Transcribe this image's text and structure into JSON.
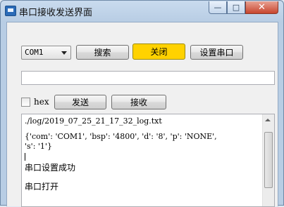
{
  "window": {
    "title": "串口接收发送界面",
    "controls": {
      "minimize": "—",
      "maximize": "□",
      "close": "✕"
    }
  },
  "toolbar": {
    "port_select": {
      "value": "COM1"
    },
    "search_label": "搜索",
    "close_label": "关闭",
    "setup_label": "设置串口"
  },
  "send_input": {
    "value": "",
    "placeholder": ""
  },
  "options": {
    "hex_label": "hex",
    "hex_checked": false,
    "send_label": "发送",
    "receive_label": "接收"
  },
  "log": {
    "lines": [
      "./log/2019_07_25_21_17_32_log.txt",
      "",
      "{'com': 'COM1', 'bsp': '4800', 'd': '8', 'p': 'NONE',",
      "'s': '1'}"
    ],
    "messages": [
      "串口设置成功",
      "串口打开"
    ]
  },
  "colors": {
    "close_button": "#ffd200",
    "titlebar": "#c9dbee"
  }
}
